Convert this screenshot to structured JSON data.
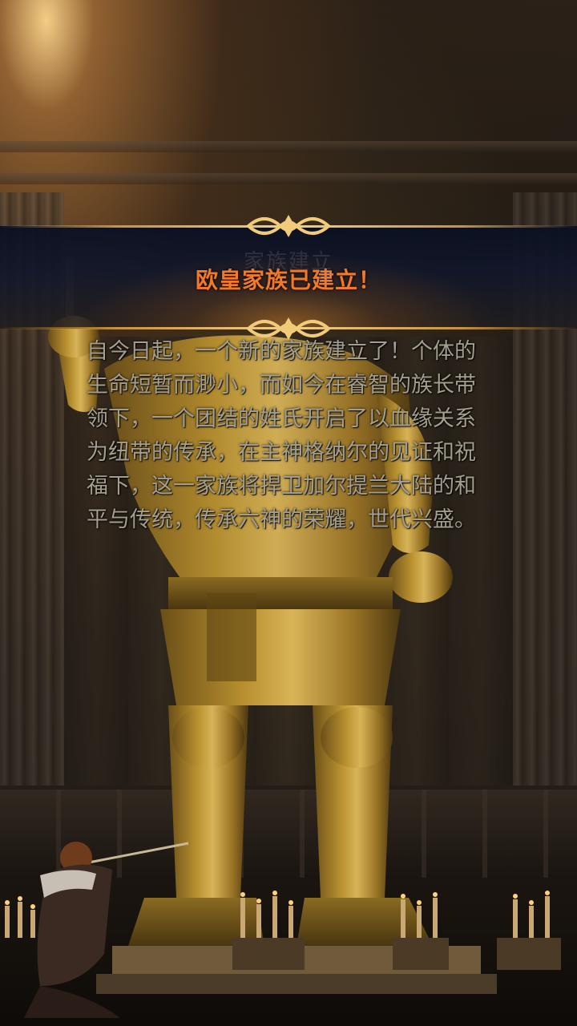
{
  "banner": {
    "watermark": "家族建立",
    "title": "欧皇家族已建立！"
  },
  "story": {
    "text": "自今日起，一个新的家族建立了！个体的生命短暂而渺小，而如今在睿智的族长带领下，一个团结的姓氏开启了以血缘关系为纽带的传承，在主神格纳尔的见证和祝福下，这一家族将捍卫加尔提兰大陆的和平与传统，传承六神的荣耀，世代兴盛。"
  },
  "colors": {
    "title": "#f07a2a",
    "body_text": "#a39e8e",
    "banner_gold": "#f3d08a",
    "banner_navy": "#0a1022"
  }
}
